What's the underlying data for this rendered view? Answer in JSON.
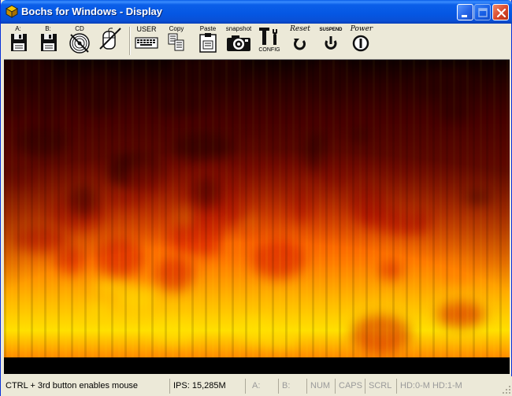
{
  "window": {
    "title": "Bochs for Windows - Display",
    "colors": {
      "titlebar": "#0557e3",
      "chrome": "#ece9d8",
      "close": "#d8472a"
    }
  },
  "toolbar": {
    "floppy_a_label": "A:",
    "floppy_b_label": "B:",
    "cdrom_label": "CD",
    "user_label": "USER",
    "copy_label": "Copy",
    "paste_label": "Paste",
    "snapshot_label": "snapshot",
    "config_label": "CONFIG",
    "reset_label": "Reset",
    "suspend_label": "SUSPEND",
    "power_label": "Power",
    "icons": [
      "floppy-disk-icon",
      "floppy-disk-icon",
      "cdrom-icon",
      "mouse-icon",
      "keyboard-icon",
      "copy-icon",
      "paste-icon",
      "camera-icon",
      "config-icon",
      "reset-icon",
      "suspend-icon",
      "power-icon"
    ]
  },
  "display": {
    "content": "fire-effect",
    "colors": {
      "dark": "#5a0000",
      "red": "#d01000",
      "orange": "#ff7a00",
      "yellow": "#ffe000"
    }
  },
  "statusbar": {
    "message": "CTRL + 3rd button enables mouse",
    "ips": "IPS: 15,285M",
    "floppy_a": "A:",
    "floppy_b": "B:",
    "num": "NUM",
    "caps": "CAPS",
    "scrl": "SCRL",
    "hd": "HD:0-M HD:1-M"
  }
}
